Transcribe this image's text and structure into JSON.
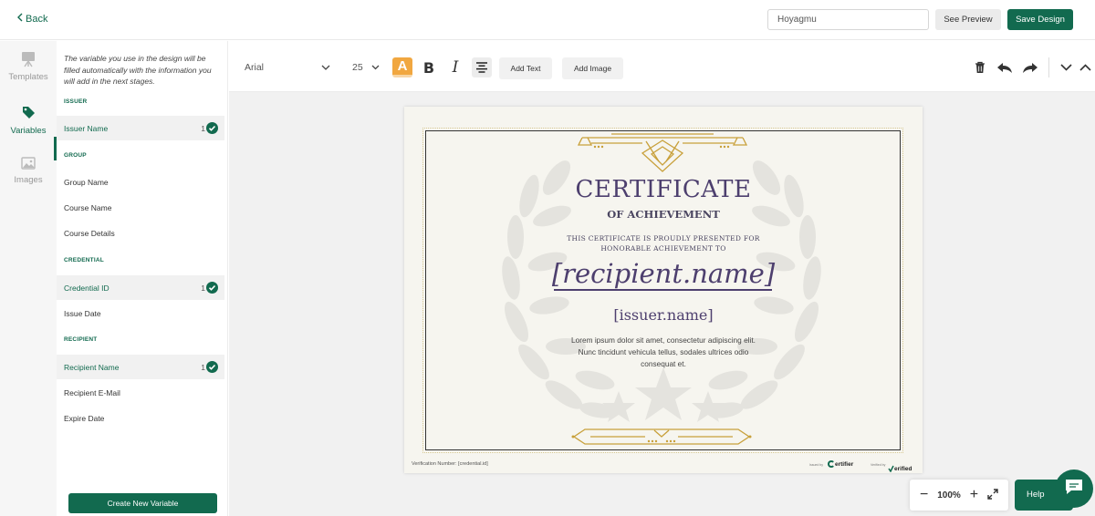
{
  "topbar": {
    "back_label": "Back",
    "design_name": "Hoyagmu",
    "preview_label": "See Preview",
    "save_label": "Save Design"
  },
  "rail": {
    "items": [
      {
        "label": "Templates"
      },
      {
        "label": "Variables"
      },
      {
        "label": "Images"
      }
    ]
  },
  "panel": {
    "hint": "The variable you use in the design will be filled automatically with the information you will add in the next stages.",
    "sections": [
      {
        "title": "ISSUER",
        "items": [
          {
            "label": "Issuer Name",
            "count": "1"
          }
        ]
      },
      {
        "title": "GROUP",
        "items": [
          {
            "label": "Group Name"
          },
          {
            "label": "Course Name"
          },
          {
            "label": "Course Details"
          }
        ]
      },
      {
        "title": "CREDENTIAL",
        "items": [
          {
            "label": "Credential ID",
            "count": "1"
          },
          {
            "label": "Issue Date"
          }
        ]
      },
      {
        "title": "RECIPIENT",
        "items": [
          {
            "label": "Recipient Name",
            "count": "1"
          },
          {
            "label": "Recipient E-Mail"
          },
          {
            "label": "Expire Date"
          }
        ]
      }
    ],
    "create_label": "Create New Variable"
  },
  "toolbar": {
    "font": "Arial",
    "size": "25",
    "text_color_glyph": "A",
    "add_text_label": "Add Text",
    "add_image_label": "Add Image"
  },
  "certificate": {
    "title": "CERTIFICATE",
    "subtitle": "OF ACHIEVEMENT",
    "presented_line1": "THIS CERTIFICATE IS PROUDLY PRESENTED FOR",
    "presented_line2": "HONORABLE ACHIEVEMENT TO",
    "recipient": "[recipient.name]",
    "issuer": "[issuer.name]",
    "body_line1": "Lorem ipsum dolor sit amet, consectetur adipiscing elit.",
    "body_line2": "Nunc tincidunt vehicula tellus, sodales ultrices odio",
    "body_line3": "consequat et.",
    "verification": "Verification Number: [credential.id]",
    "powered_by": "Issued by",
    "brand1": "ertifier",
    "verified_by": "Verified by",
    "brand2": "erified"
  },
  "zoom": {
    "level": "100%"
  },
  "help": {
    "label": "Help"
  },
  "colors": {
    "brand": "#126a4f",
    "accent": "#f1a740",
    "gold": "#c8a03a",
    "purple": "#4d3f6e"
  }
}
